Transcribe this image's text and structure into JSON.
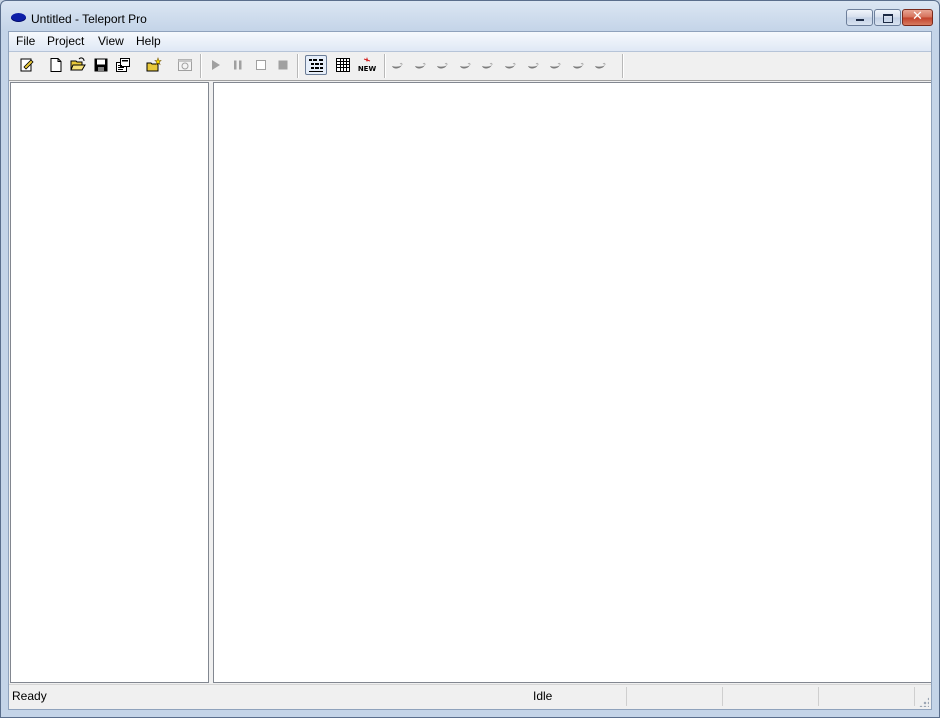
{
  "window": {
    "title": "Untitled - Teleport Pro",
    "icons": {
      "app": "teleport-app-icon",
      "minimize": "minimize-icon",
      "maximize": "maximize-icon",
      "close": "close-icon"
    },
    "close_glyph": "✕"
  },
  "menu": {
    "items": [
      {
        "label": "File"
      },
      {
        "label": "Project"
      },
      {
        "label": "View"
      },
      {
        "label": "Help"
      }
    ]
  },
  "toolbar": {
    "buttons": [
      "project-properties-icon",
      "new-project-icon",
      "open-project-icon",
      "save-project-icon",
      "project-settings-icon",
      "new-address-icon",
      "browse-icon",
      "start-icon",
      "pause-icon",
      "stop-icon",
      "abort-icon",
      "tree-view-icon",
      "detail-view-icon",
      "new-files-icon"
    ],
    "new_label": "NEW",
    "thread_indicators": 10,
    "thread_icon": "thread-idle-icon"
  },
  "colors": {
    "title_accent": "#0c1ea8",
    "close_button": "#c2402a",
    "pane_background": "#ffffff",
    "chrome": "#f0f0f0"
  },
  "status": {
    "message": "Ready",
    "state": "Idle"
  }
}
